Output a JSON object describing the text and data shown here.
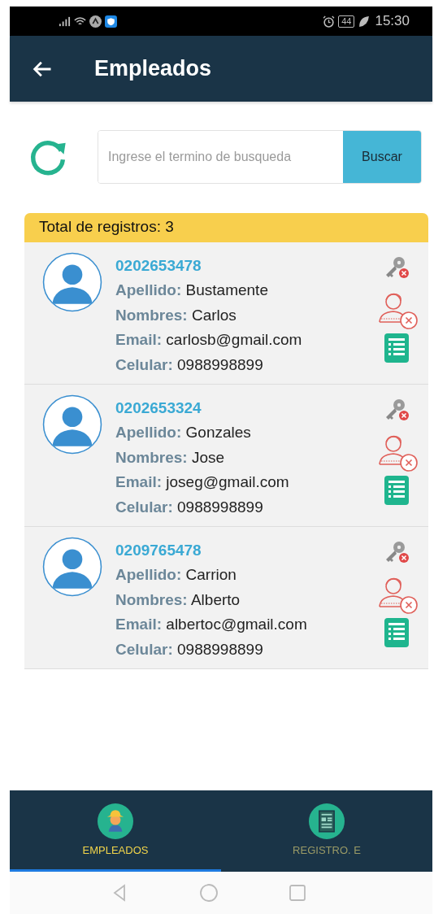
{
  "status_bar": {
    "battery": "44",
    "time": "15:30"
  },
  "app_bar": {
    "title": "Empleados"
  },
  "search": {
    "placeholder": "Ingrese el termino de busqueda",
    "button": "Buscar"
  },
  "total": "Total de registros: 3",
  "employees": [
    {
      "id": "0202653478",
      "fields": [
        {
          "label": "Apellido:",
          "value": "Bustamente"
        },
        {
          "label": "Nombres:",
          "value": "Carlos"
        },
        {
          "label": "Email:",
          "value": "carlosb@gmail.com"
        },
        {
          "label": "Celular:",
          "value": "0988998899"
        }
      ]
    },
    {
      "id": "0202653324",
      "fields": [
        {
          "label": "Apellido:",
          "value": "Gonzales"
        },
        {
          "label": "Nombres:",
          "value": "Jose"
        },
        {
          "label": "Email:",
          "value": "joseg@gmail.com"
        },
        {
          "label": "Celular:",
          "value": "0988998899"
        }
      ]
    },
    {
      "id": "0209765478",
      "fields": [
        {
          "label": "Apellido:",
          "value": "Carrion"
        },
        {
          "label": "Nombres:",
          "value": "Alberto"
        },
        {
          "label": "Email:",
          "value": "albertoc@gmail.com"
        },
        {
          "label": "Celular:",
          "value": "0988998899"
        }
      ]
    }
  ],
  "bottom_tabs": [
    {
      "label": "EMPLEADOS",
      "kind": "worker",
      "selected": true
    },
    {
      "label": "REGISTRO. E",
      "kind": "document",
      "selected": false
    }
  ]
}
